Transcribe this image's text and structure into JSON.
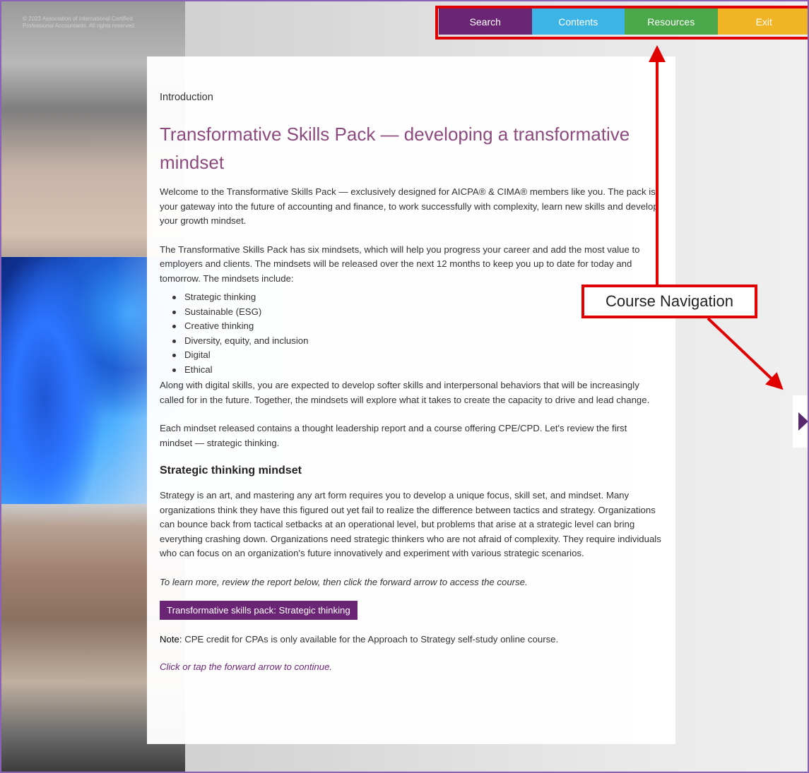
{
  "header": {
    "copyright": "© 2023 Association of International Certified Professional Accountants. All rights reserved."
  },
  "nav": {
    "items": [
      {
        "label": "Search",
        "color": "#6b2575"
      },
      {
        "label": "Contents",
        "color": "#3cb4e6"
      },
      {
        "label": "Resources",
        "color": "#4aa74a"
      },
      {
        "label": "Exit",
        "color": "#f1b424"
      }
    ]
  },
  "content": {
    "breadcrumb": "Introduction",
    "title": "Transformative Skills Pack — developing a transformative mindset",
    "intro_p1": "Welcome to the Transformative Skills Pack — exclusively designed for AICPA® & CIMA® members like you. The pack is your gateway into the future of accounting and finance, to work successfully with complexity, learn new skills and develop your growth mindset.",
    "intro_p2": "The Transformative Skills Pack has six mindsets, which will help you progress your career and add the most value to employers and clients. The mindsets will be released over the next 12 months to keep you up to date for today and tomorrow. The mindsets include:",
    "mindsets": [
      "Strategic thinking",
      "Sustainable (ESG)",
      "Creative thinking",
      "Diversity, equity, and inclusion",
      "Digital",
      "Ethical"
    ],
    "p3": "Along with digital skills, you are expected to develop softer skills and interpersonal behaviors that will be increasingly called for in the future. Together, the mindsets will explore what it takes to create the capacity to drive and lead change.",
    "p4": "Each mindset released contains a thought leadership report and a course offering CPE/CPD. Let's review the first mindset — strategic thinking.",
    "subheading": "Strategic thinking mindset",
    "p5": "Strategy is an art, and mastering any art form requires you to develop a unique focus, skill set, and mindset. Many organizations think they have this figured out yet fail to realize the difference between tactics and strategy. Organizations can bounce back from tactical setbacks at an operational level, but problems that arise at a strategic level can bring everything crashing down. Organizations need strategic thinkers who are not afraid of complexity. They require individuals who can focus on an organization's future innovatively and experiment with various strategic scenarios.",
    "instruction": "To learn more, review the report below, then click the forward arrow to access the course.",
    "report_button": "Transformative skills pack: Strategic thinking",
    "note_label": "Note:",
    "note_text": " CPE credit for CPAs is only available for the Approach to Strategy self-study online course.",
    "continue_text": "Click or tap the forward arrow to continue."
  },
  "annotation": {
    "label": "Course Navigation",
    "color": "#e00000"
  },
  "icons": {
    "forward": "forward-arrow-icon"
  }
}
